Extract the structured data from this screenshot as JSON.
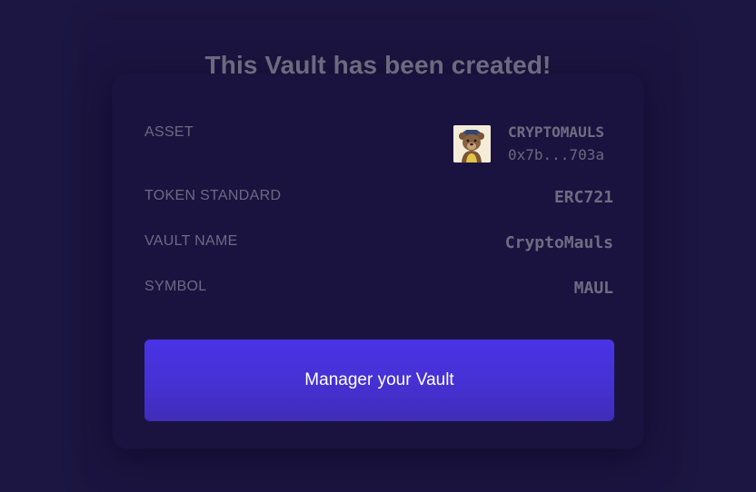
{
  "dialog": {
    "title": "This Vault has been created!"
  },
  "details": {
    "asset": {
      "label": "ASSET",
      "name": "CRYPTOMAULS",
      "address": "0x7b...703a",
      "thumbnail_icon": "bear-nft-thumbnail"
    },
    "token_standard": {
      "label": "TOKEN STANDARD",
      "value": "ERC721"
    },
    "vault_name": {
      "label": "VAULT NAME",
      "value": "CryptoMauls"
    },
    "symbol": {
      "label": "SYMBOL",
      "value": "MAUL"
    }
  },
  "actions": {
    "manage_label": "Manager your Vault"
  },
  "colors": {
    "background": "#1c1642",
    "card": "#1a1340",
    "button": "#4a33e6",
    "muted_text": "#6e6a7e"
  }
}
